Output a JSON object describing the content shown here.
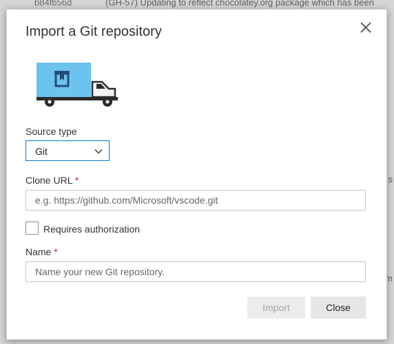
{
  "background": {
    "commit_hash": "b84fb56d",
    "commit_message": "(GH-57) Updating to reflect chocolatey.org package which has been",
    "edge_chars": [
      "s",
      "m"
    ]
  },
  "dialog": {
    "title": "Import a Git repository",
    "close_icon": "close-icon",
    "illustration_icon": "truck-icon",
    "source_type": {
      "label": "Source type",
      "selected": "Git"
    },
    "clone_url": {
      "label": "Clone URL",
      "required_mark": "*",
      "value": "",
      "placeholder": "e.g. https://github.com/Microsoft/vscode.git"
    },
    "requires_auth": {
      "label": "Requires authorization",
      "checked": false
    },
    "name": {
      "label": "Name",
      "required_mark": "*",
      "value": "",
      "placeholder": "Name your new Git repository."
    },
    "buttons": {
      "import_label": "Import",
      "close_label": "Close"
    }
  },
  "colors": {
    "accent": "#0078d4",
    "required": "#c62828",
    "truck_box": "#6cc3ee"
  }
}
